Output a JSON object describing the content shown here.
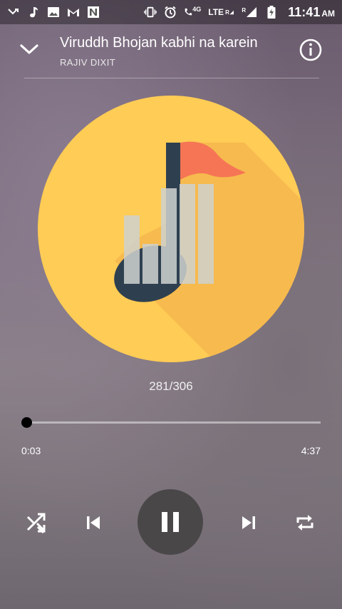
{
  "status_bar": {
    "time": "11:41",
    "ampm": "AM",
    "network_label": "4G",
    "lte_label": "LTE",
    "roaming_1": "R",
    "roaming_2": "R"
  },
  "header": {
    "title": "Viruddh Bhojan kabhi na karein",
    "artist": "RAJIV DIXIT"
  },
  "track": {
    "counter": "281/306",
    "elapsed": "0:03",
    "duration": "4:37",
    "progress_fraction": 0.011
  },
  "colors": {
    "art_circle": "#ffcc55",
    "flag": "#f57555",
    "note_dark": "#2e4050",
    "play_button": "#4a4749"
  }
}
